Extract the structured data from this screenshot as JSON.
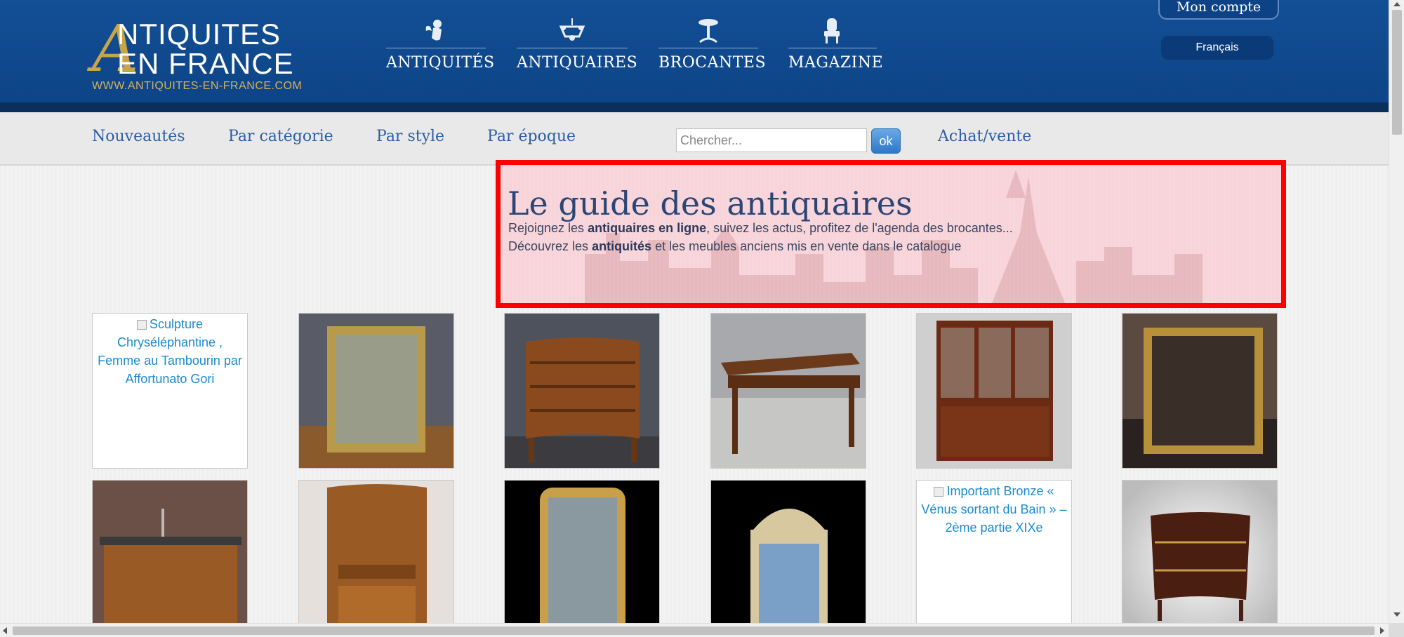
{
  "header": {
    "logo": {
      "big_letter": "A",
      "line1": "NTIQUITES",
      "line2": "EN FRANCE",
      "url": "WWW.ANTIQUITES-EN-FRANCE.COM"
    },
    "nav": [
      {
        "label": "ANTIQUITÉS",
        "icon": "cherub-icon"
      },
      {
        "label": "ANTIQUAIRES",
        "icon": "chandelier-icon"
      },
      {
        "label": "BROCANTES",
        "icon": "pedestal-table-icon"
      },
      {
        "label": "MAGAZINE",
        "icon": "armchair-icon"
      }
    ],
    "account_label": "Mon compte",
    "language": "Français"
  },
  "subnav": {
    "links": [
      "Nouveautés",
      "Par catégorie",
      "Par style",
      "Par époque"
    ],
    "search_placeholder": "Chercher...",
    "search_button": "ok",
    "trade_link": "Achat/vente"
  },
  "hero": {
    "title": "Le guide des antiquaires",
    "line1_pre": "Rejoignez les ",
    "line1_bold": "antiquaires en ligne",
    "line1_post": ", suivez les actus, profitez de l'agenda des brocantes...",
    "line2_pre": "Découvrez les ",
    "line2_bold": "antiquités",
    "line2_post": " et les meubles anciens mis en vente dans le catalogue"
  },
  "products": [
    {
      "alt": "Sculpture Chryséléphantine , Femme au Tambourin par Affortunato Gori",
      "broken": true
    },
    {
      "depicts": "gilt mirror"
    },
    {
      "depicts": "walnut chest of drawers"
    },
    {
      "depicts": "farm table"
    },
    {
      "depicts": "mahogany glazed bookcase"
    },
    {
      "depicts": "gilt frame mirror"
    },
    {
      "depicts": "oak sideboard"
    },
    {
      "depicts": "art nouveau cabinet"
    },
    {
      "depicts": "rococo gilt mirror"
    },
    {
      "depicts": "carved trumeau mirror"
    },
    {
      "alt": "Important Bronze « Vénus sortant du Bain » – 2ème partie XIXe",
      "broken": true
    },
    {
      "depicts": "Louis XV commode"
    }
  ],
  "colors": {
    "header": "#134f95",
    "accent_gold": "#c9a54a",
    "link_blue": "#2b5ea3",
    "hero_border": "#ff0000"
  }
}
